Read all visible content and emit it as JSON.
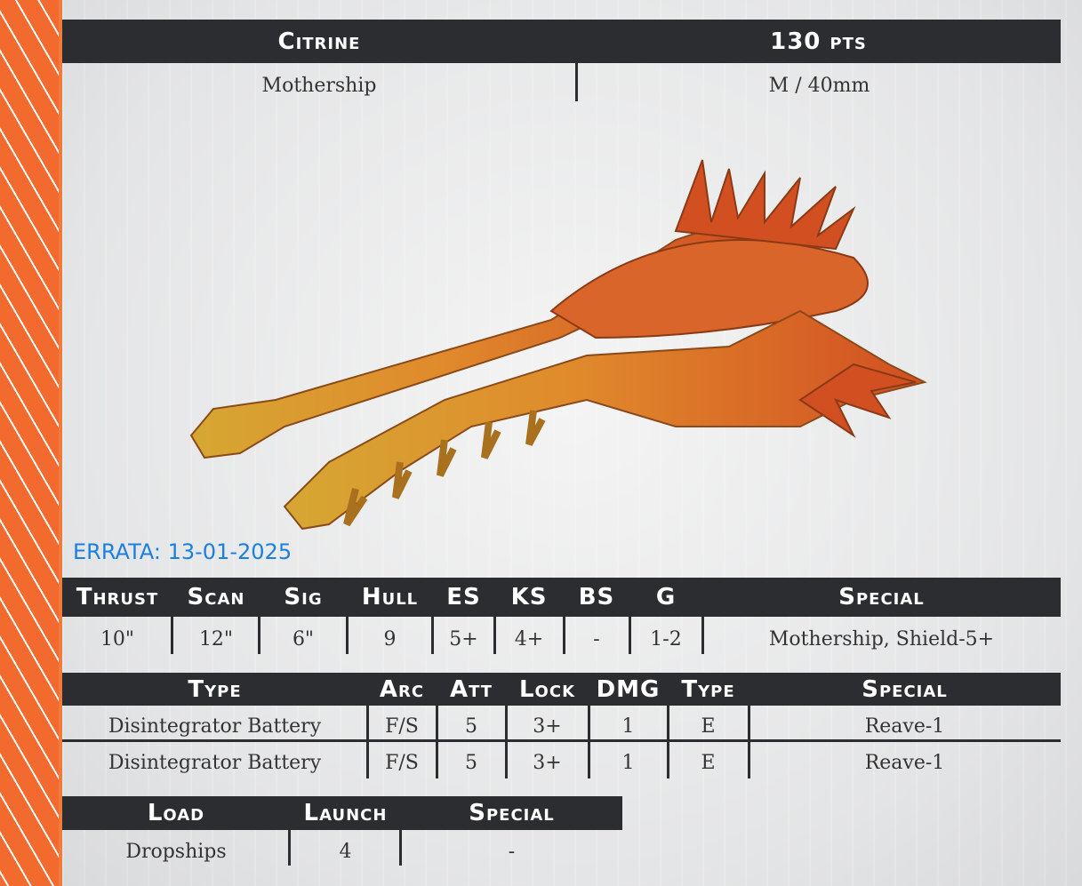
{
  "title": {
    "name": "Citrine",
    "points": "130 pts"
  },
  "subtitle": {
    "class": "Mothership",
    "size": "M / 40mm"
  },
  "errata": "ERRATA: 13-01-2025",
  "stats": {
    "headers": [
      "Thrust",
      "Scan",
      "Sig",
      "Hull",
      "ES",
      "KS",
      "BS",
      "G",
      "Special"
    ],
    "values": [
      "10\"",
      "12\"",
      "6\"",
      "9",
      "5+",
      "4+",
      "-",
      "1-2",
      "Mothership, Shield-5+"
    ]
  },
  "weapons": {
    "headers": [
      "Type",
      "Arc",
      "Att",
      "Lock",
      "DMG",
      "Type",
      "Special"
    ],
    "rows": [
      [
        "Disintegrator Battery",
        "F/S",
        "5",
        "3+",
        "1",
        "E",
        "Reave-1"
      ],
      [
        "Disintegrator Battery",
        "F/S",
        "5",
        "3+",
        "1",
        "E",
        "Reave-1"
      ]
    ]
  },
  "launch": {
    "headers": [
      "Load",
      "Launch",
      "Special"
    ],
    "values": [
      "Dropships",
      "4",
      "-"
    ]
  },
  "colors": {
    "accent": "#f26a2e",
    "header": "#2b2d31",
    "errata": "#1b7fe0"
  }
}
